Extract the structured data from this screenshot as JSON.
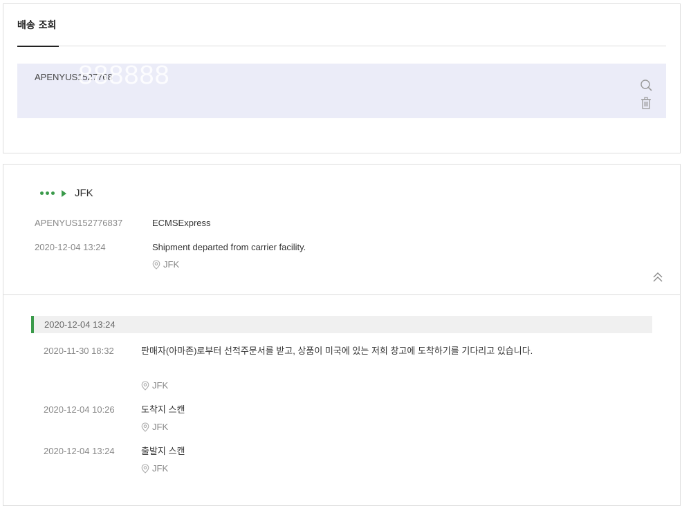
{
  "search_panel": {
    "tab_label": "배송 조회",
    "tracking_input_value": "APENYUS1527768",
    "watermark": "888888"
  },
  "result": {
    "destination": "JFK",
    "tracking_number": "APENYUS152776837",
    "carrier": "ECMSExpress",
    "latest_time": "2020-12-04 13:24",
    "latest_status": "Shipment departed from carrier facility.",
    "latest_location": "JFK",
    "timeline_header": "2020-12-04 13:24",
    "events": [
      {
        "time": "2020-11-30 18:32",
        "description": "판매자(아마존)로부터 선적주문서를 받고, 상품이 미국에 있는 저희 창고에 도착하기를 기다리고 있습니다.",
        "location": "JFK"
      },
      {
        "time": "2020-12-04 10:26",
        "description": "도착지 스캔",
        "location": "JFK"
      },
      {
        "time": "2020-12-04 13:24",
        "description": "출발지 스캔",
        "location": "JFK"
      }
    ]
  },
  "icons": {
    "search": "search-icon",
    "trash": "trash-icon",
    "pin": "location-pin-icon",
    "collapse": "double-chevron-up-icon"
  },
  "colors": {
    "accent_green": "#3a9a4a",
    "search_box_bg": "#ebecf8"
  }
}
